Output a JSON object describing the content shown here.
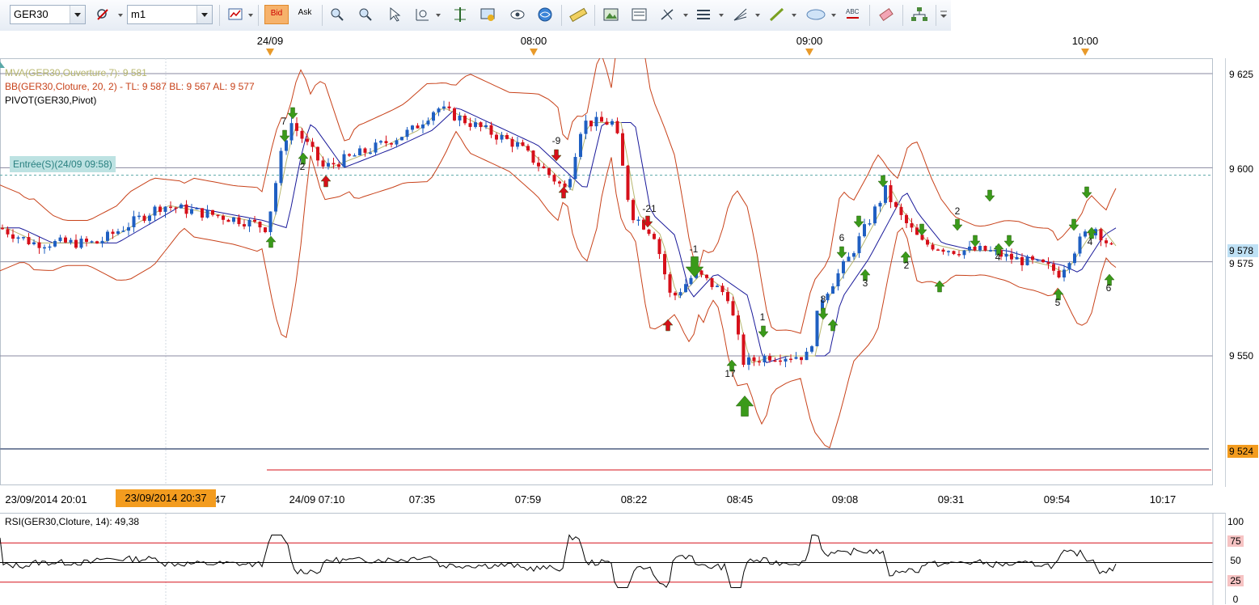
{
  "toolbar": {
    "symbol": "GER30",
    "timeframe": "m1",
    "bid_label": "Bid",
    "ask_label": "Ask"
  },
  "time_axis_top": [
    "24/09",
    "08:00",
    "09:00",
    "10:00"
  ],
  "legend": {
    "mva": "MVA(GER30,Ouverture,7): 9 581",
    "bb": "BB(GER30,Cloture, 20, 2) -   TL: 9 587  BL: 9 567   AL: 9 577",
    "pivot": "PIVOT(GER30,Pivot)"
  },
  "entry_label": "Entrée(S)(24/09 09:58)",
  "price_scale": [
    "9 625",
    "9 600",
    "9 578",
    "9 575",
    "9 550",
    "9 524"
  ],
  "price_scale_highlight_color": "#bfe1f5",
  "price_scale_bottom_color": "#f39c1f",
  "time_axis_bottom": [
    "23/09/2014 20:01",
    "47",
    "24/09 07:10",
    "07:35",
    "07:59",
    "08:22",
    "08:45",
    "09:08",
    "09:31",
    "09:54",
    "10:17"
  ],
  "time_axis_highlight": "23/09/2014 20:37",
  "rsi": {
    "label": "RSI(GER30,Cloture, 14): 49,38",
    "levels": [
      "100",
      "75",
      "50",
      "25",
      "0"
    ]
  },
  "pattern_labels": [
    "7",
    "2",
    "-9",
    "-21",
    "-1",
    "1",
    "17",
    "8",
    "6",
    "3",
    "2",
    "2",
    "4",
    "5",
    "4",
    "6"
  ],
  "colors": {
    "up_candle": "#1f5fc2",
    "down_candle": "#d6101a",
    "bollinger": "#c8421a",
    "mva": "#b7b66e",
    "pivot_line": "#1a1a9a",
    "signal_up": "#3a9a1a",
    "signal_down": "#d6101a"
  }
}
